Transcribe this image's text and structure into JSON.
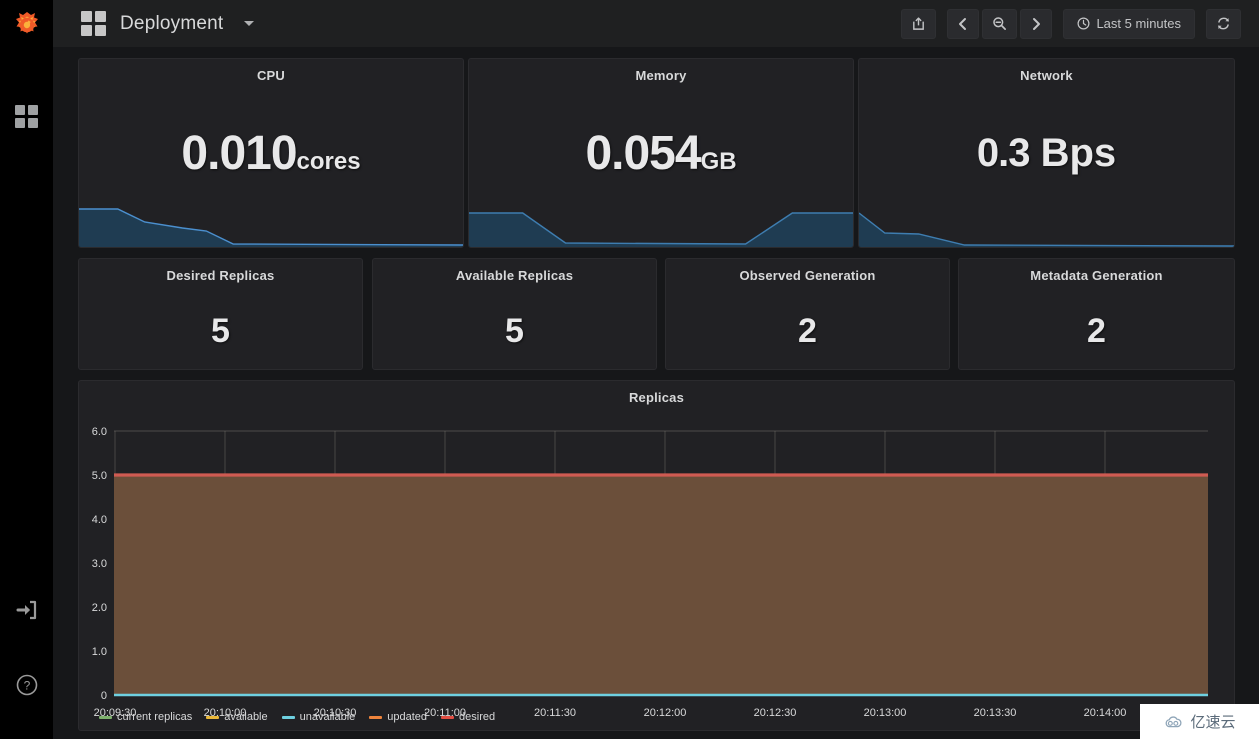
{
  "app": {
    "logo_icon": "grafana-logo-icon",
    "sidebar_items": [
      {
        "icon": "dashboards-grid-icon",
        "name": "dashboards"
      },
      {
        "icon": "sign-in-icon",
        "name": "sign-in"
      },
      {
        "icon": "help-circle-icon",
        "name": "help"
      }
    ]
  },
  "navbar": {
    "dashboard_icon": "dashboard-grid-icon",
    "title": "Deployment",
    "caret_icon": "chevron-down-icon",
    "toolbar": {
      "share_icon": "share-icon",
      "prev_icon": "chevron-left-icon",
      "zoom_out_icon": "zoom-out-icon",
      "next_icon": "chevron-right-icon",
      "time_clock_icon": "clock-icon",
      "time_range": "Last 5 minutes",
      "refresh_icon": "refresh-icon"
    }
  },
  "stat_panels": [
    {
      "title": "CPU",
      "value": "0.010",
      "unit": "cores",
      "unit_spaced": false
    },
    {
      "title": "Memory",
      "value": "0.054",
      "unit": "GB",
      "unit_spaced": false
    },
    {
      "title": "Network",
      "value": "0.3",
      "unit": "Bps",
      "unit_spaced": true
    }
  ],
  "count_panels": [
    {
      "title": "Desired Replicas",
      "value": "5"
    },
    {
      "title": "Available Replicas",
      "value": "5"
    },
    {
      "title": "Observed Generation",
      "value": "2"
    },
    {
      "title": "Metadata Generation",
      "value": "2"
    }
  ],
  "graph": {
    "title": "Replicas"
  },
  "chart_data": [
    {
      "type": "area",
      "title": "CPU",
      "ylabel": "cores",
      "x": [
        0,
        0.1,
        0.17,
        0.27,
        0.33,
        0.4,
        1.0
      ],
      "values": [
        1.0,
        1.0,
        0.72,
        0.6,
        0.55,
        0.04,
        0.03
      ],
      "series": [
        {
          "name": "cpu",
          "values": [
            1.0,
            1.0,
            0.72,
            0.6,
            0.55,
            0.04,
            0.03
          ]
        }
      ],
      "line_color": "#4b8fce",
      "fill_color": "#1f3c52",
      "grid": false,
      "legend": "none"
    },
    {
      "type": "area",
      "title": "Memory",
      "ylabel": "GB",
      "x": [
        0,
        0.14,
        0.25,
        0.72,
        0.84,
        1.0
      ],
      "values": [
        1.0,
        1.0,
        0.06,
        0.06,
        1.0,
        1.0
      ],
      "series": [
        {
          "name": "memory",
          "values": [
            1.0,
            1.0,
            0.06,
            0.06,
            1.0,
            1.0
          ]
        }
      ],
      "line_color": "#3e7db0",
      "fill_color": "#1f3c52",
      "grid": false,
      "legend": "none"
    },
    {
      "type": "area",
      "title": "Network",
      "ylabel": "Bps",
      "x": [
        0,
        0.07,
        0.16,
        0.28,
        1.0
      ],
      "values": [
        1.0,
        0.45,
        0.42,
        0.03,
        0.02
      ],
      "series": [
        {
          "name": "network",
          "values": [
            1.0,
            0.45,
            0.42,
            0.03,
            0.02
          ]
        }
      ],
      "line_color": "#3e7db0",
      "fill_color": "#1f3c52",
      "grid": false,
      "legend": "none"
    },
    {
      "type": "line",
      "title": "Replicas",
      "xlabel": "",
      "ylabel": "",
      "ylim": [
        0,
        6
      ],
      "yticks": [
        "0",
        "1.0",
        "2.0",
        "3.0",
        "4.0",
        "5.0",
        "6.0"
      ],
      "ytick_values": [
        0,
        1,
        2,
        3,
        4,
        5,
        6
      ],
      "xticks": [
        "20:09:30",
        "20:10:00",
        "20:10:30",
        "20:11:00",
        "20:11:30",
        "20:12:00",
        "20:12:30",
        "20:13:00",
        "20:13:30",
        "20:14:00"
      ],
      "grid": true,
      "legend_position": "bottom-left",
      "series": [
        {
          "name": "current replicas",
          "color": "#7eb26d",
          "values": [
            5,
            5,
            5,
            5,
            5,
            5,
            5,
            5,
            5,
            5
          ],
          "filled": true
        },
        {
          "name": "available",
          "color": "#eab839",
          "values": [
            5,
            5,
            5,
            5,
            5,
            5,
            5,
            5,
            5,
            5
          ],
          "filled": true
        },
        {
          "name": "unavailable",
          "color": "#6ed0e0",
          "values": [
            0,
            0,
            0,
            0,
            0,
            0,
            0,
            0,
            0,
            0
          ],
          "filled": false
        },
        {
          "name": "updated",
          "color": "#ef843c",
          "values": [
            5,
            5,
            5,
            5,
            5,
            5,
            5,
            5,
            5,
            5
          ],
          "filled": true
        },
        {
          "name": "desired",
          "color": "#e24d42",
          "values": [
            5,
            5,
            5,
            5,
            5,
            5,
            5,
            5,
            5,
            5
          ],
          "filled": false
        }
      ],
      "fill_color": "#6b4f3a"
    }
  ],
  "watermark": {
    "text": "亿速云",
    "icon": "cloud-icon"
  }
}
